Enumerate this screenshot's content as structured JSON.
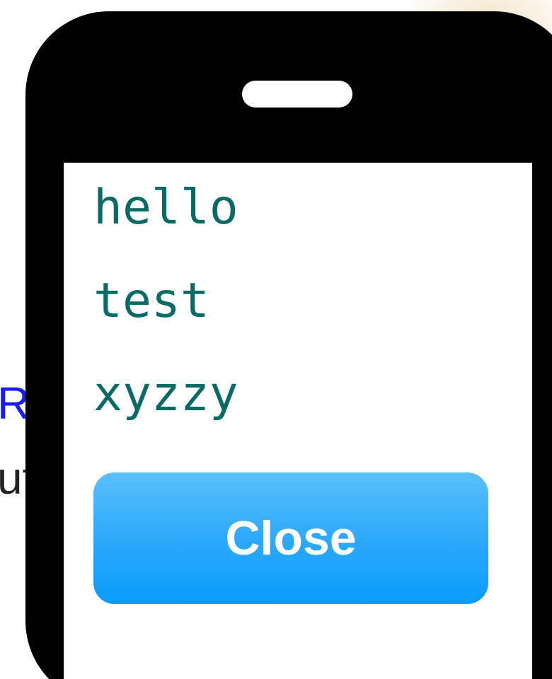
{
  "background": {
    "line1_text": "RT",
    "line2_text": "ut",
    "line1_color": "#1a1aff",
    "line2_color": "#222222"
  },
  "phone": {
    "frame_color": "#000000",
    "screen": {
      "lines": [
        "hello",
        "test",
        "xyzzy"
      ],
      "text_color": "#0a6b66",
      "close_button_label": "Close",
      "button_color": "#1aa3fb"
    }
  }
}
